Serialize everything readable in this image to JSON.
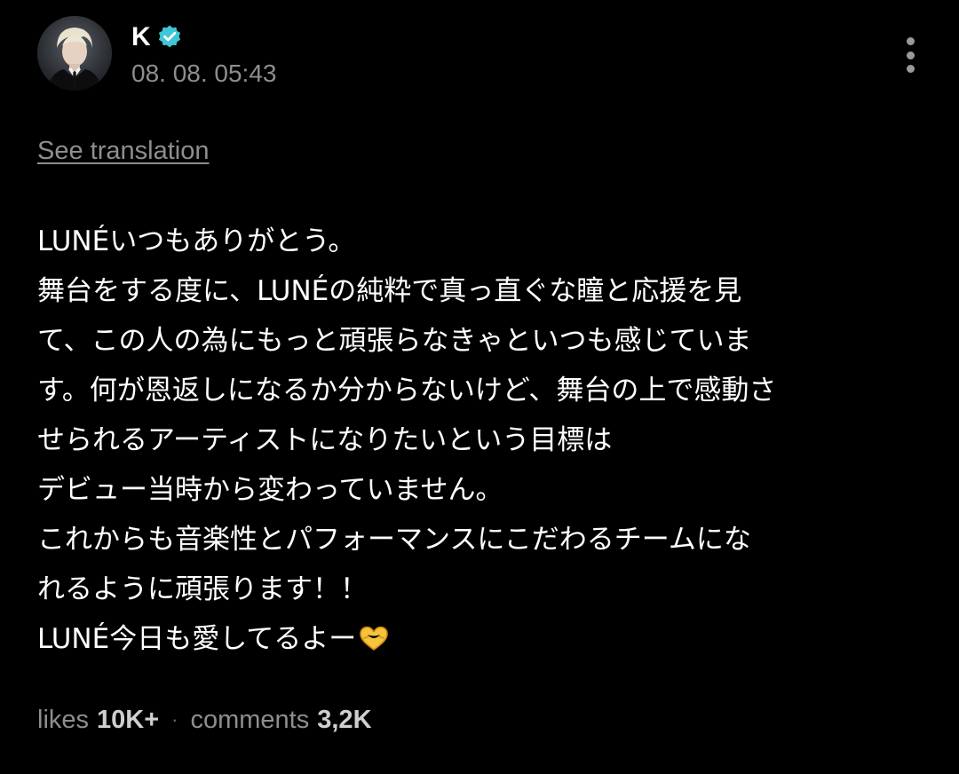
{
  "author": {
    "name": "K",
    "verified_color": "#3ec7d6",
    "avatar_icon": "profile-photo"
  },
  "post": {
    "timestamp": "08. 08. 05:43",
    "see_translation": "See translation",
    "lines": [
      "LUNÉいつもありがとう。",
      "舞台をする度に、LUNÉの純粋で真っ直ぐな瞳と応援を見",
      "て、この人の為にもっと頑張らなきゃといつも感じていま",
      "す。何が恩返しになるか分からないけど、舞台の上で感動さ",
      "せられるアーティストになりたいという目標は",
      "デビュー当時から変わっていません。",
      "これからも音楽性とパフォーマンスにこだわるチームにな",
      "れるように頑張ります！！",
      "LUNÉ今日も愛してるよー"
    ],
    "emoji": "heart-hands-emoji"
  },
  "stats": {
    "likes_label": "likes",
    "likes_value": "10K+",
    "separator": "·",
    "comments_label": "comments",
    "comments_value": "3,2K"
  },
  "icons": {
    "more": "more-vertical-icon",
    "verified": "verified-badge-icon"
  }
}
